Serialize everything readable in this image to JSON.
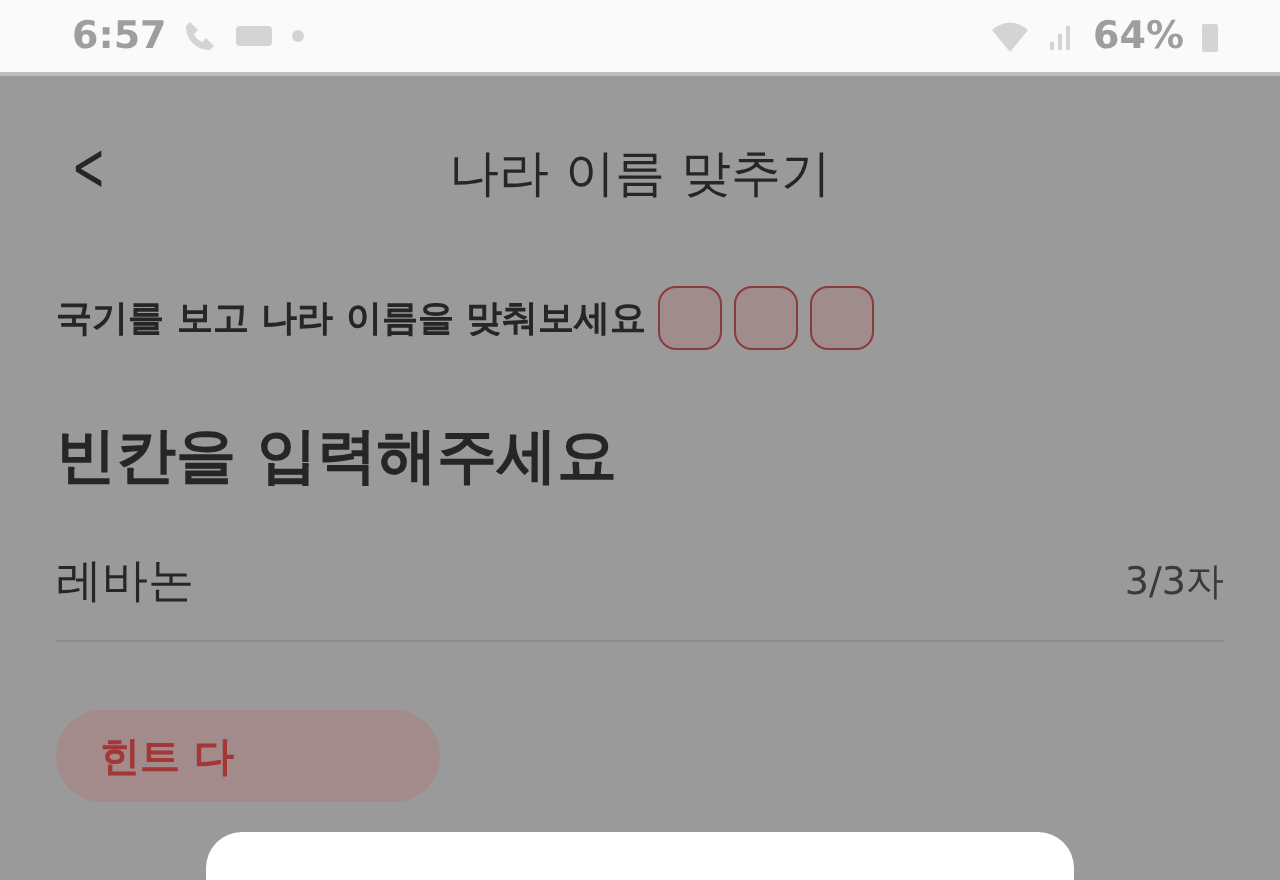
{
  "status_bar": {
    "time": "6:57",
    "battery": "64%"
  },
  "header": {
    "back_icon": "<",
    "title": "나라 이름 맞추기"
  },
  "instruction": "국기를 보고 나라 이름을 맞춰보세요",
  "slots": [
    {
      "kind": "empty"
    },
    {
      "kind": "empty"
    },
    {
      "kind": "empty"
    }
  ],
  "heading": "빈칸을 입력해주세요",
  "answer_field": {
    "value": "레바논",
    "counter": "3/3자"
  },
  "hint_button": {
    "label": "힌트 다"
  },
  "dialog": {
    "kind": "sheet"
  }
}
